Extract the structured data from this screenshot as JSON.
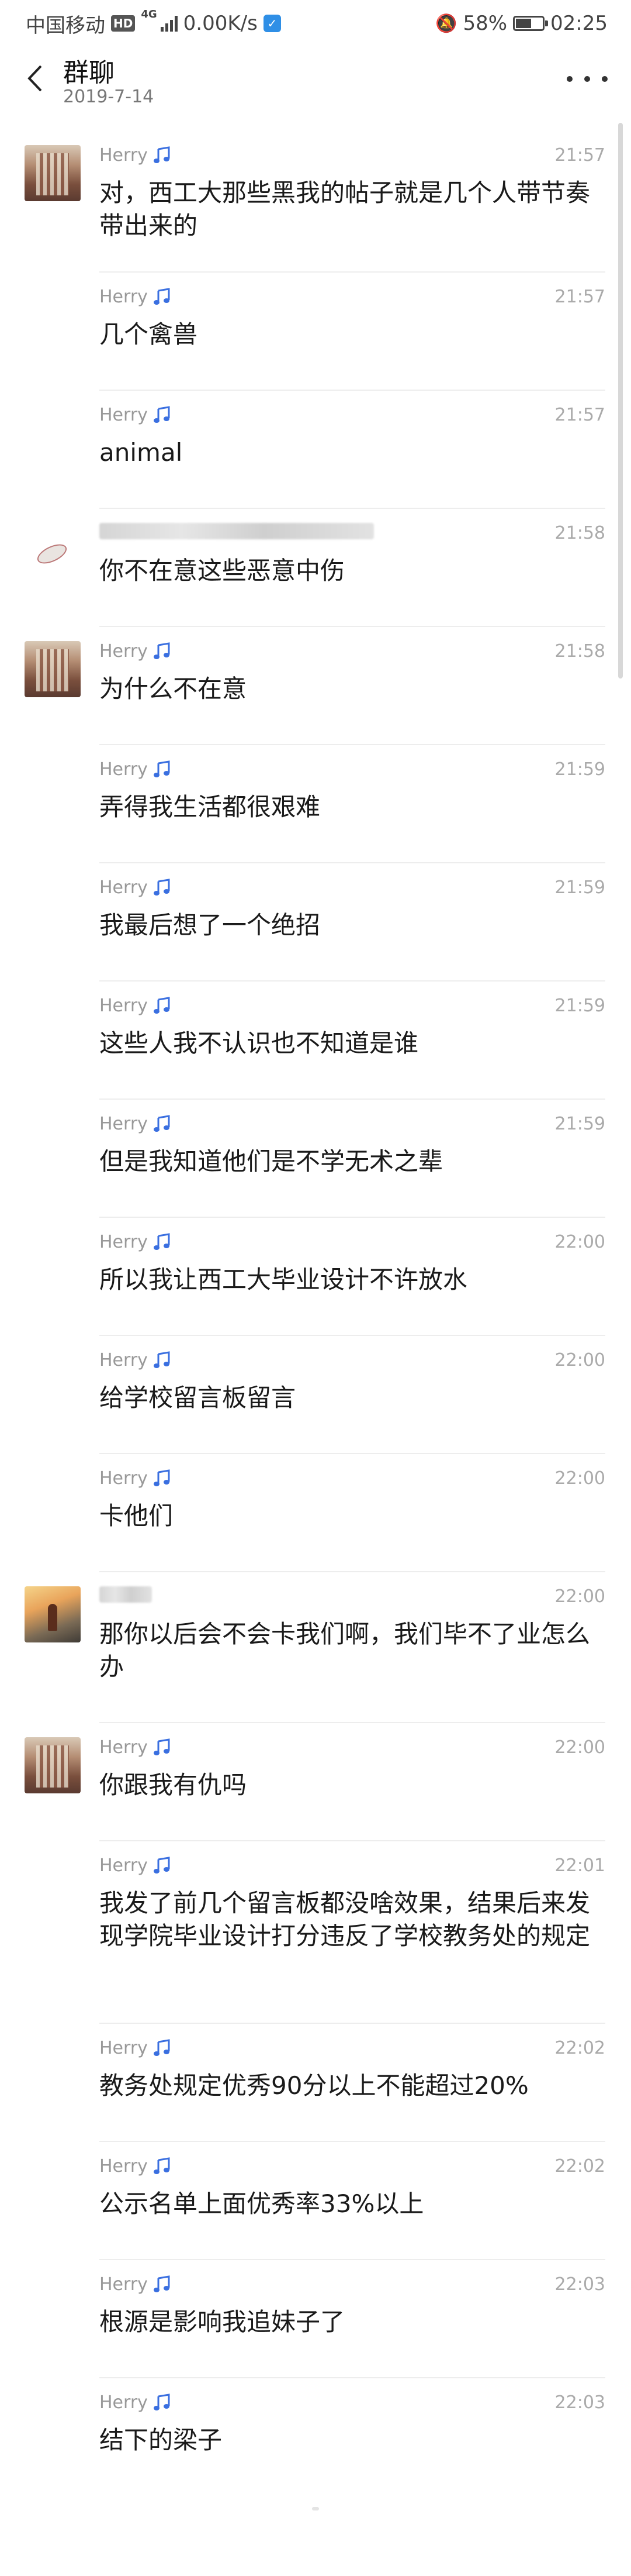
{
  "status_bar": {
    "carrier": "中国移动",
    "hd": "HD",
    "network": "4G",
    "speed": "0.00K/s",
    "battery": "58%",
    "battery_level": 0.58,
    "time": "02:25"
  },
  "header": {
    "title": "群聊",
    "date": "2019-7-14"
  },
  "messages": [
    {
      "sender": "Herry",
      "time": "21:57",
      "text": "对，西工大那些黑我的帖子就是几个人带节奏带出来的",
      "avatar": "building"
    },
    {
      "sender": "Herry",
      "time": "21:57",
      "text": "几个禽兽"
    },
    {
      "sender": "Herry",
      "time": "21:57",
      "text": "animal"
    },
    {
      "sender": "",
      "time": "21:58",
      "text": "你不在意这些恶意中伤",
      "avatar": "bird"
    },
    {
      "sender": "Herry",
      "time": "21:58",
      "text": "为什么不在意",
      "avatar": "building"
    },
    {
      "sender": "Herry",
      "time": "21:59",
      "text": "弄得我生活都很艰难"
    },
    {
      "sender": "Herry",
      "time": "21:59",
      "text": "我最后想了一个绝招"
    },
    {
      "sender": "Herry",
      "time": "21:59",
      "text": "这些人我不认识也不知道是谁"
    },
    {
      "sender": "Herry",
      "time": "21:59",
      "text": "但是我知道他们是不学无术之辈"
    },
    {
      "sender": "Herry",
      "time": "22:00",
      "text": "所以我让西工大毕业设计不许放水"
    },
    {
      "sender": "Herry",
      "time": "22:00",
      "text": "给学校留言板留言"
    },
    {
      "sender": "Herry",
      "time": "22:00",
      "text": "卡他们"
    },
    {
      "sender": "",
      "time": "22:00",
      "text": "那你以后会不会卡我们啊，我们毕不了业怎么办",
      "avatar": "hiker"
    },
    {
      "sender": "Herry",
      "time": "22:00",
      "text": "你跟我有仇吗",
      "avatar": "building"
    },
    {
      "sender": "Herry",
      "time": "22:01",
      "text": "我发了前几个留言板都没啥效果，结果后来发现学院毕业设计打分违反了学校教务处的规定"
    },
    {
      "sender": "Herry",
      "time": "22:02",
      "text": "教务处规定优秀90分以上不能超过20%"
    },
    {
      "sender": "Herry",
      "time": "22:02",
      "text": "公示名单上面优秀率33%以上"
    },
    {
      "sender": "Herry",
      "time": "22:03",
      "text": "根源是影响我追妹子了"
    },
    {
      "sender": "Herry",
      "time": "22:03",
      "text": "结下的梁子"
    }
  ]
}
